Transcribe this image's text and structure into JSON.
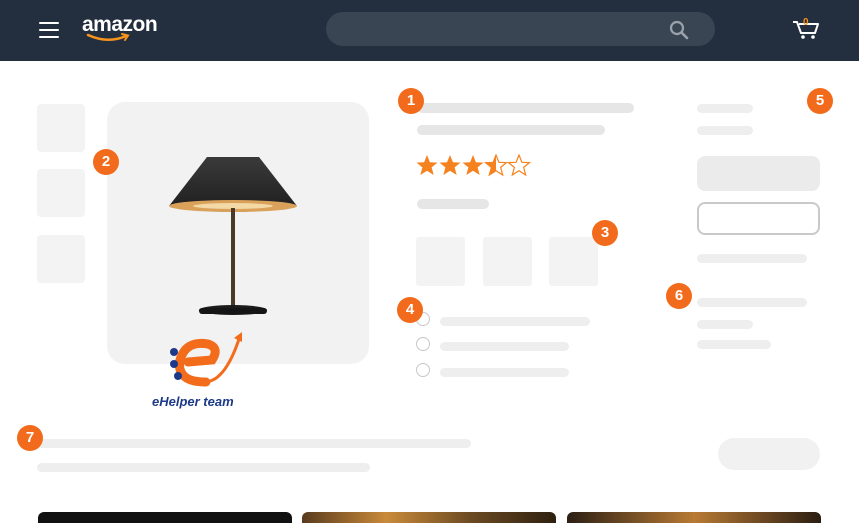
{
  "header": {
    "logo_text": "amazon",
    "cart_count": "0",
    "colors": {
      "bar": "#232f3e",
      "accent": "#f7941d",
      "search_bg": "#3a4553"
    }
  },
  "callouts": [
    "1",
    "2",
    "3",
    "4",
    "5",
    "6",
    "7"
  ],
  "product": {
    "rating": 3.5,
    "rating_max": 5,
    "image_icon": "table-lamp"
  },
  "watermark": {
    "text": "eHelper team"
  },
  "colors": {
    "badge": "#f26a1b",
    "star": "#f5821f",
    "placeholder": "#e6e6e6"
  }
}
